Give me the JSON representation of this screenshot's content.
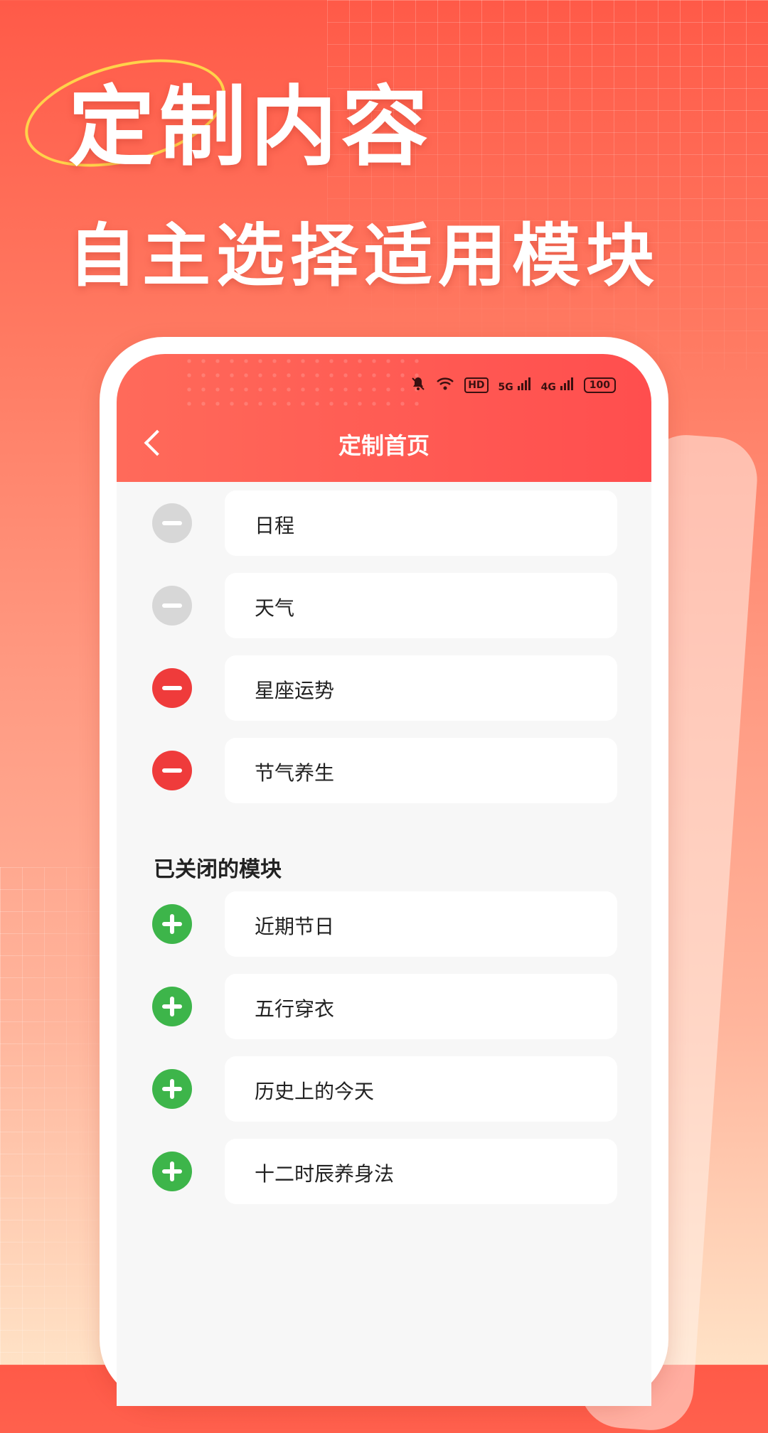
{
  "promo": {
    "headline_1": "定制内容",
    "headline_2": "自主选择适用模块"
  },
  "status_bar": {
    "net_1": "HD",
    "net_2": "5G",
    "net_3": "4G",
    "battery": "100"
  },
  "app": {
    "title": "定制首页"
  },
  "enabled_modules": [
    {
      "label": "日程",
      "state": "locked"
    },
    {
      "label": "天气",
      "state": "locked"
    },
    {
      "label": "星座运势",
      "state": "removable"
    },
    {
      "label": "节气养生",
      "state": "removable"
    }
  ],
  "closed_section": {
    "title": "已关闭的模块",
    "items": [
      {
        "label": "近期节日"
      },
      {
        "label": "五行穿衣"
      },
      {
        "label": "历史上的今天"
      },
      {
        "label": "十二时辰养身法"
      }
    ]
  },
  "colors": {
    "accent_red": "#ef3b3b",
    "add_green": "#3db54a",
    "disabled_gray": "#d7d7d7"
  }
}
